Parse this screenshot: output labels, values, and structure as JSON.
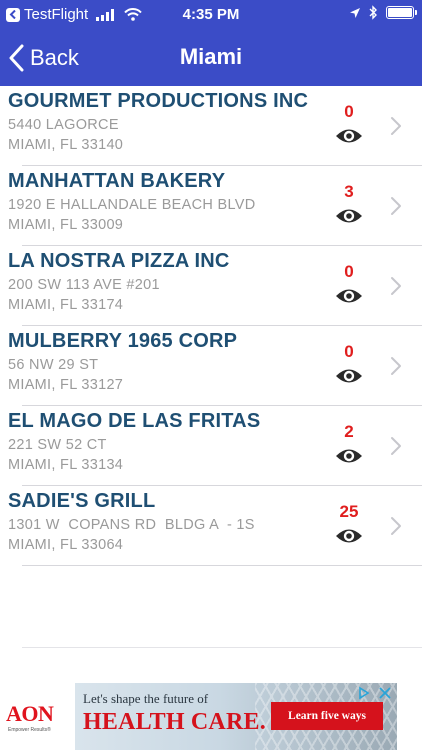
{
  "status_bar": {
    "back_app": "TestFlight",
    "time": "4:35 PM"
  },
  "nav": {
    "back_label": "Back",
    "title": "Miami"
  },
  "colors": {
    "nav_background": "#3b4cc7",
    "name_text": "#1f4f73",
    "count_text": "#e01e1e",
    "secondary_text": "#9a9a9a"
  },
  "icons": {
    "item_view": "eye-icon",
    "item_disclosure": "chevron-right-icon",
    "back": "chevron-left-icon"
  },
  "restaurants": [
    {
      "name": "GOURMET PRODUCTIONS INC",
      "address": "5440 LAGORCE",
      "city": "MIAMI, FL 33140",
      "count": "0"
    },
    {
      "name": "MANHATTAN BAKERY",
      "address": "1920 E HALLANDALE BEACH BLVD",
      "city": "MIAMI, FL 33009",
      "count": "3"
    },
    {
      "name": "LA NOSTRA PIZZA INC",
      "address": "200 SW 113 AVE #201",
      "city": "MIAMI, FL 33174",
      "count": "0"
    },
    {
      "name": "MULBERRY 1965 CORP",
      "address": "56 NW 29 ST",
      "city": "MIAMI, FL 33127",
      "count": "0"
    },
    {
      "name": "EL MAGO DE LAS FRITAS",
      "address": "221 SW 52 CT",
      "city": "MIAMI, FL 33134",
      "count": "2"
    },
    {
      "name": "SADIE'S GRILL",
      "address": "1301 W  COPANS RD  BLDG A  - 1S",
      "city": "MIAMI, FL 33064",
      "count": "25"
    }
  ],
  "ad": {
    "brand": "AON",
    "brand_sub": "Empower Results®",
    "tagline": "Let's shape the future of",
    "headline": "HEALTH CARE.",
    "cta": "Learn five ways"
  }
}
